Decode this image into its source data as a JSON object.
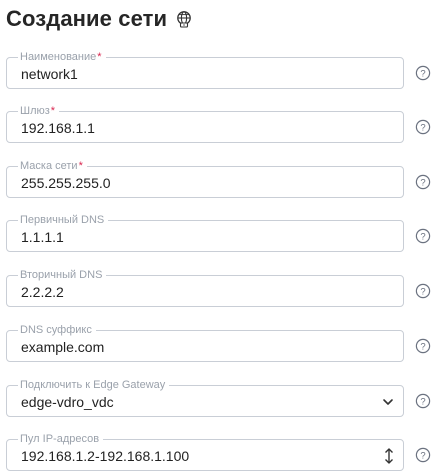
{
  "header": {
    "title": "Создание сети",
    "icon": "globe-network-icon"
  },
  "fields": {
    "name": {
      "label": "Наименование",
      "required": "*",
      "value": "network1"
    },
    "gateway": {
      "label": "Шлюз",
      "required": "*",
      "value": "192.168.1.1"
    },
    "netmask": {
      "label": "Маска сети",
      "required": "*",
      "value": "255.255.255.0"
    },
    "dns1": {
      "label": "Первичный DNS",
      "value": "1.1.1.1"
    },
    "dns2": {
      "label": "Вторичный DNS",
      "value": "2.2.2.2"
    },
    "dns_suffix": {
      "label": "DNS суффикс",
      "value": "example.com"
    },
    "edge_gateway": {
      "label": "Подключить к Edge Gateway",
      "value": "edge-vdro_vdc"
    },
    "ip_pool": {
      "label": "Пул IP-адресов",
      "value": "192.168.1.2-192.168.1.100"
    }
  },
  "icons": {
    "help": "question-circle-icon",
    "dropdown": "chevron-down-icon",
    "resize": "up-down-arrow-icon"
  },
  "colors": {
    "required": "#d9264f",
    "border": "#c9ced6",
    "label": "#9aa1ab"
  }
}
